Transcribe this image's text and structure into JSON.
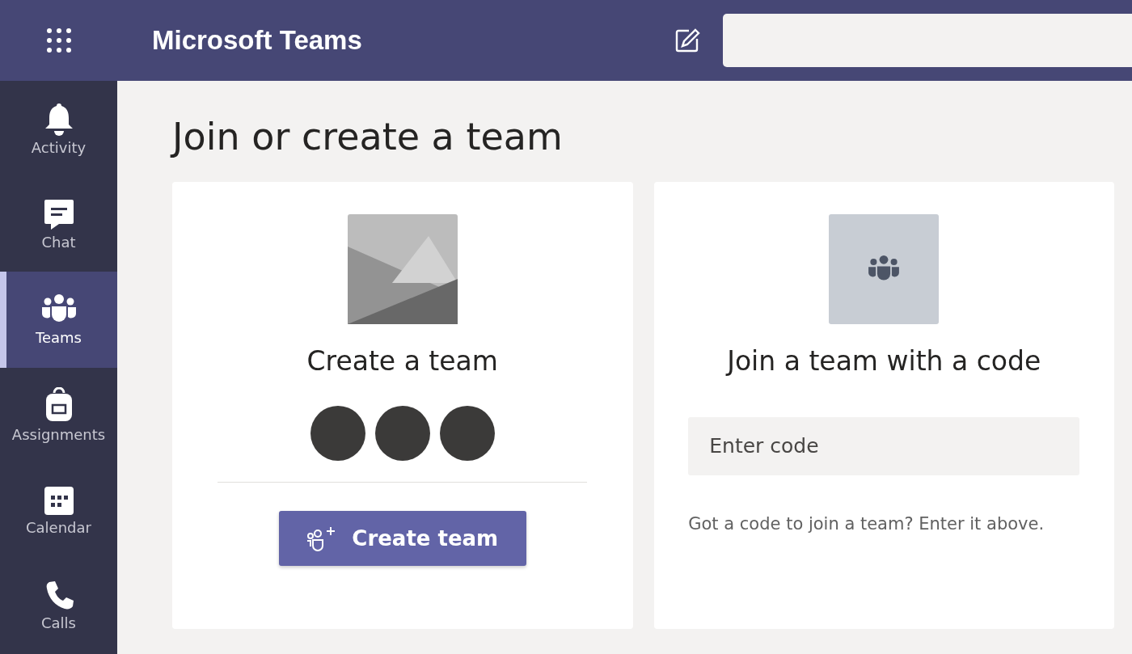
{
  "app": {
    "title": "Microsoft Teams"
  },
  "rail": [
    {
      "kind": "bell",
      "label": "Activity",
      "selected": false
    },
    {
      "kind": "chat",
      "label": "Chat",
      "selected": false
    },
    {
      "kind": "teams",
      "label": "Teams",
      "selected": true
    },
    {
      "kind": "bag",
      "label": "Assignments",
      "selected": false
    },
    {
      "kind": "calendar",
      "label": "Calendar",
      "selected": false
    },
    {
      "kind": "phone",
      "label": "Calls",
      "selected": false
    }
  ],
  "page_title": "Join or create a team",
  "create_card": {
    "title": "Create a team",
    "button": "Create team"
  },
  "join_card": {
    "title": "Join a team with a code",
    "code_field": {
      "placeholder": "Enter code"
    },
    "hint": "Got a code to join a team? Enter it above."
  }
}
